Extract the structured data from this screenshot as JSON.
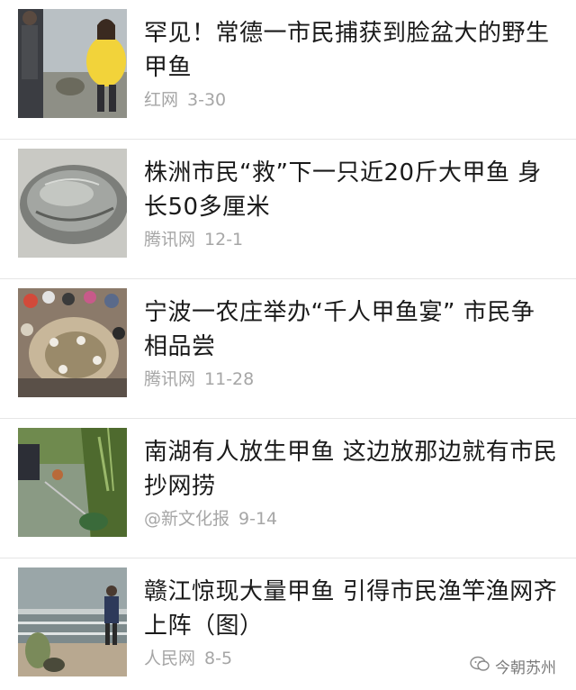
{
  "items": [
    {
      "title": "罕见！常德一市民捕获到脸盆大的野生甲鱼",
      "source": "红网",
      "date": "3-30",
      "thumb": "photo-people-with-turtle"
    },
    {
      "title": "株洲市民“救”下一只近20斤大甲鱼 身长50多厘米",
      "source": "腾讯网",
      "date": "12-1",
      "thumb": "photo-turtle-shell"
    },
    {
      "title": "宁波一农庄举办“千人甲鱼宴” 市民争相品尝",
      "source": "腾讯网",
      "date": "11-28",
      "thumb": "photo-banquet-crowd"
    },
    {
      "title": "南湖有人放生甲鱼 这边放那边就有市民抄网捞",
      "source": "@新文化报",
      "date": "9-14",
      "thumb": "photo-lake-netting"
    },
    {
      "title": "赣江惊现大量甲鱼 引得市民渔竿渔网齐上阵（图）",
      "source": "人民网",
      "date": "8-5",
      "thumb": "photo-riverbank"
    }
  ],
  "watermark": {
    "text": "今朝苏州",
    "icon": "wechat-channel-icon"
  },
  "colors": {
    "title": "#1a1a1a",
    "meta": "#a6a6a6",
    "divider": "#e6e6e6"
  }
}
